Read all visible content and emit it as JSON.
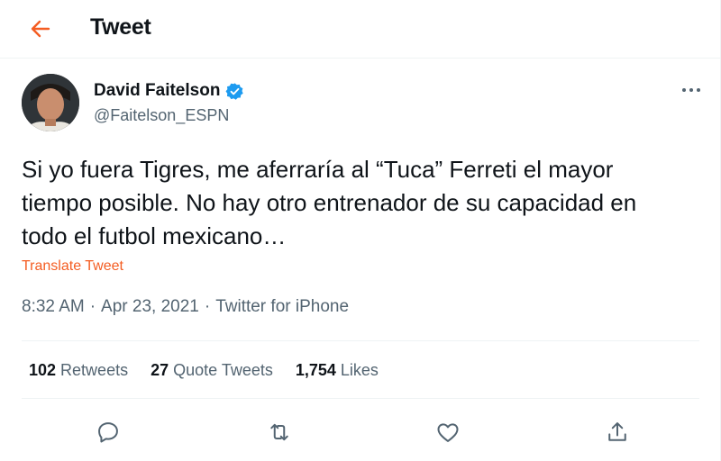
{
  "header": {
    "title": "Tweet"
  },
  "author": {
    "name": "David Faitelson",
    "handle": "@Faitelson_ESPN"
  },
  "tweet": {
    "text": "Si yo fuera Tigres, me aferraría al “Tuca” Ferreti el mayor tiempo posible. No hay otro entrenador de su capacidad en todo el futbol mexicano…",
    "translate_label": "Translate Tweet"
  },
  "meta": {
    "time": "8:32 AM",
    "sep": "·",
    "date": "Apr 23, 2021",
    "source": "Twitter for iPhone"
  },
  "stats": {
    "retweets": {
      "count": "102",
      "label": "Retweets"
    },
    "quotes": {
      "count": "27",
      "label": "Quote Tweets"
    },
    "likes": {
      "count": "1,754",
      "label": "Likes"
    }
  },
  "colors": {
    "accent": "#f45d22",
    "verified": "#1d9bf0",
    "muted": "#536471",
    "text": "#0f1419"
  },
  "icons": [
    "back-arrow-icon",
    "verified-badge-icon",
    "more-icon",
    "reply-icon",
    "retweet-icon",
    "like-icon",
    "share-icon"
  ]
}
